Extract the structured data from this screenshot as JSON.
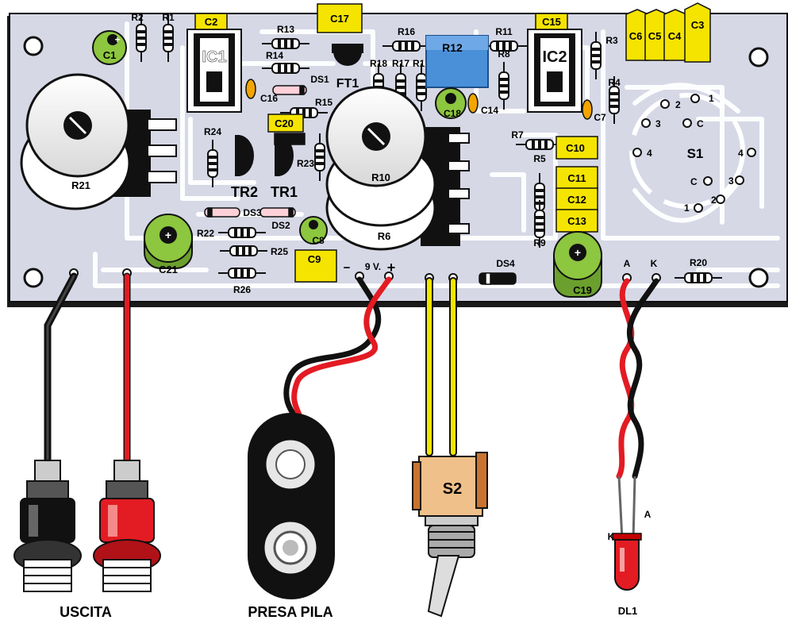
{
  "colors": {
    "pcb": "#d6d8e6",
    "trace": "#ffffff",
    "capacitor_yellow": "#f5e400",
    "electrolytic_green": "#8dc63f",
    "wire_red": "#e31b23",
    "wire_yellow": "#f2e600",
    "wire_black": "#111111",
    "trimmer_blue": "#4a90d9",
    "switch_brown": "#c8742f"
  },
  "board": {
    "resistors": [
      "R1",
      "R2",
      "R3",
      "R4",
      "R5",
      "R6",
      "R7",
      "R8",
      "R9",
      "R10",
      "R11",
      "R12",
      "R13",
      "R14",
      "R15",
      "R16",
      "R17",
      "R18",
      "R19",
      "R20",
      "R21",
      "R22",
      "R23",
      "R24",
      "R25",
      "R26"
    ],
    "ics": [
      "IC1",
      "IC2"
    ],
    "capacitors": [
      "C1",
      "C2",
      "C3",
      "C4",
      "C5",
      "C6",
      "C7",
      "C8",
      "C9",
      "C10",
      "C11",
      "C12",
      "C13",
      "C14",
      "C15",
      "C16",
      "C17",
      "C18",
      "C19",
      "C20",
      "C21"
    ],
    "transistors": [
      "TR1",
      "TR2",
      "FT1"
    ],
    "diodes": [
      "DS1",
      "DS2",
      "DS3",
      "DS4"
    ],
    "switch_s1": "S1",
    "s1_pins": [
      "1",
      "2",
      "3",
      "4",
      "C"
    ],
    "battery_label": "9 V.",
    "minus": "−",
    "plus": "+",
    "anode": "A",
    "cathode": "K"
  },
  "offboard": {
    "output_label": "USCITA",
    "battery_clip_label": "PRESA PILA",
    "switch_label": "S2",
    "led_label": "DL1",
    "led_anode": "A",
    "led_cathode": "K"
  }
}
